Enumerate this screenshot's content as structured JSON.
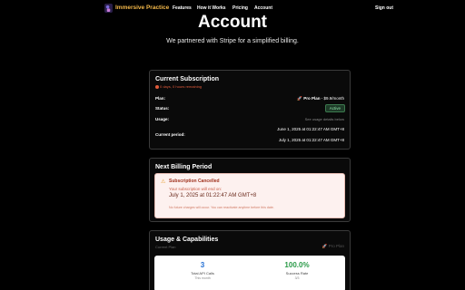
{
  "nav": {
    "brand": "Immersive Practice",
    "links": [
      "Features",
      "How it Works",
      "Pricing",
      "Account"
    ],
    "signout": "Sign out"
  },
  "header": {
    "title": "Account",
    "subtitle": "We partnered with Stripe for a simplified billing."
  },
  "subscription": {
    "title": "Current Subscription",
    "remaining": "0 days, 0 hours remaining",
    "plan_label": "Plan:",
    "plan_value": "Pro Plan",
    "plan_price": "- $9.9/month",
    "status_label": "Status:",
    "status_value": "Active",
    "usage_label": "Usage:",
    "usage_link": "See usage details below",
    "period_label": "Current period:",
    "period_start": "June 1, 2025 at 01:22:47 AM GMT+8",
    "period_end": "July 1, 2025 at 01:22:47 AM GMT+8"
  },
  "billing": {
    "title": "Next Billing Period",
    "alert_title": "Subscription Cancelled",
    "alert_line": "Your subscription will end on:",
    "alert_date": "July 1, 2025 at 01:22:47 AM GMT+8",
    "alert_note": "No future charges will occur. You can reactivate anytime before this date."
  },
  "usage": {
    "title": "Usage & Capabilities",
    "current_plan_label": "Current Plan",
    "plan_chip": "Pro Plan",
    "stats": [
      {
        "value": "3",
        "label": "Total API Calls",
        "sub": "This month"
      },
      {
        "value": "100.0%",
        "label": "Success Rate",
        "sub": "3/3"
      }
    ]
  },
  "colors": {
    "brand": "#f5b94a",
    "alert_bg": "#fdf1ef",
    "active": "#8fe0a8",
    "stat_blue": "#2470d4",
    "stat_green": "#2a9a48"
  }
}
